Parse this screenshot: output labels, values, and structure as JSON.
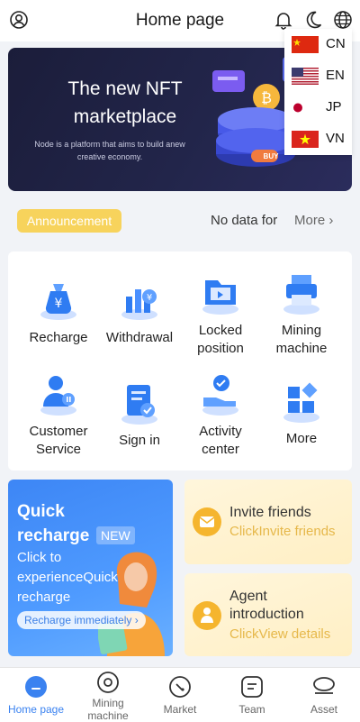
{
  "header": {
    "title": "Home page"
  },
  "languages": [
    {
      "code": "CN"
    },
    {
      "code": "EN"
    },
    {
      "code": "JP"
    },
    {
      "code": "VN"
    }
  ],
  "banner": {
    "headline": "The new NFT marketplace",
    "subtitle": "Node is a platform that aims to build anew creative economy.",
    "buy_label": "BUY"
  },
  "announcement": {
    "badge": "Announcement",
    "text": "No data for",
    "more": "More"
  },
  "grid": [
    {
      "label": "Recharge",
      "icon": "money-bag-icon"
    },
    {
      "label": "Withdrawal",
      "icon": "bar-chart-yen-icon"
    },
    {
      "label": "Locked position",
      "icon": "folder-icon"
    },
    {
      "label": "Mining machine",
      "icon": "printer-icon"
    },
    {
      "label": "Customer Service",
      "icon": "customer-service-icon"
    },
    {
      "label": "Sign in",
      "icon": "sign-in-document-icon"
    },
    {
      "label": "Activity center",
      "icon": "activity-hand-icon"
    },
    {
      "label": "More",
      "icon": "more-grid-icon"
    }
  ],
  "quick_recharge": {
    "title": "Quick recharge",
    "badge": "NEW",
    "desc": "Click to experienceQuick recharge",
    "button": "Recharge immediately"
  },
  "invite": {
    "title": "Invite friends",
    "subtitle": "ClickInvite friends"
  },
  "agent": {
    "title": "Agent introduction",
    "subtitle": "ClickView details"
  },
  "tabs": [
    {
      "label": "Home page",
      "icon": "home-icon",
      "active": true
    },
    {
      "label": "Mining machine",
      "icon": "mining-icon",
      "active": false
    },
    {
      "label": "Market",
      "icon": "market-icon",
      "active": false
    },
    {
      "label": "Team",
      "icon": "team-icon",
      "active": false
    },
    {
      "label": "Asset",
      "icon": "asset-icon",
      "active": false
    }
  ],
  "colors": {
    "accent": "#3a82f0",
    "announcement_badge": "#f7d35c",
    "side_card": "#fff3d6"
  }
}
